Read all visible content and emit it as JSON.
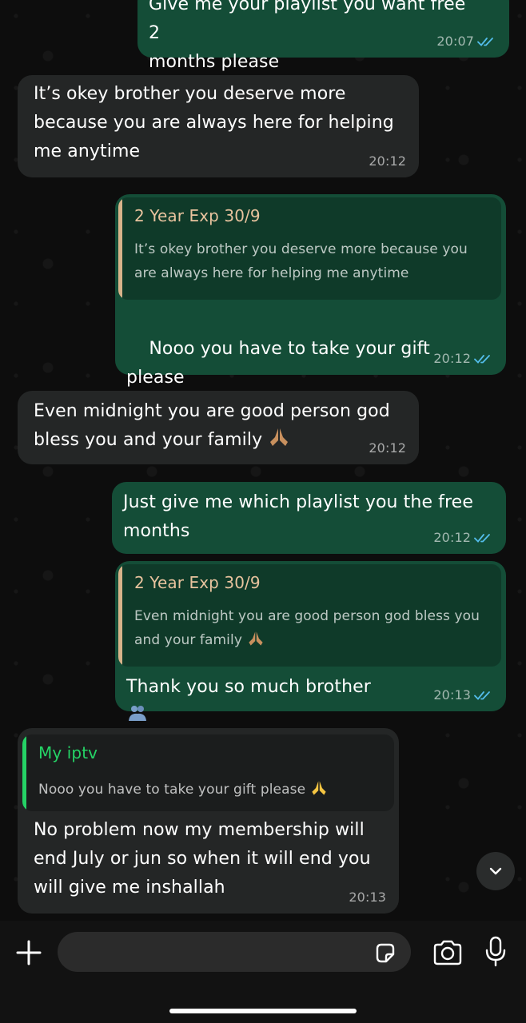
{
  "messages": [
    {
      "dir": "out",
      "text": "Give me your playlist you want free 2\nmonths please",
      "time": "20:07"
    },
    {
      "dir": "in",
      "text": "It’s okey brother you deserve more\nbecause you are always here for helping\nme anytime",
      "time": "20:12"
    },
    {
      "dir": "out",
      "quote_author": "2 Year Exp 30/9",
      "quote_text": "It’s okey brother you deserve more because you are always here for helping me anytime",
      "text": "Nooo you have to take your gift please",
      "time": "20:12"
    },
    {
      "dir": "in",
      "text": "Even midnight you are good person god\nbless you and your family",
      "time": "20:12"
    },
    {
      "dir": "out",
      "text": "Just give me which playlist you the free\nmonths",
      "time": "20:12"
    },
    {
      "dir": "out",
      "quote_author": "2 Year Exp 30/9",
      "quote_text": "Even midnight you are good person god bless you and your family",
      "text": "Thank you so much brother",
      "time": "20:13"
    },
    {
      "dir": "in",
      "quote_author": "My iptv",
      "quote_text": "Nooo you have to take your gift please",
      "text": "No problem now my membership will\nend July or jun so when it will end you\nwill give me inshallah",
      "time": "20:13"
    }
  ],
  "icons": {
    "read_receipt": "double-check-icon",
    "scroll_down": "chevron-down-icon",
    "attach": "plus-icon",
    "sticker": "sticker-icon",
    "camera": "camera-icon",
    "mic": "microphone-icon"
  },
  "colors": {
    "incoming_bubble": "#242626",
    "outgoing_bubble": "#144d37",
    "read_tick": "#53bdeb",
    "quote_author_out": "#e8c39e",
    "quote_author_in": "#25d366",
    "quote_bar_out": "#d8b38a",
    "quote_bar_in": "#25d366"
  }
}
